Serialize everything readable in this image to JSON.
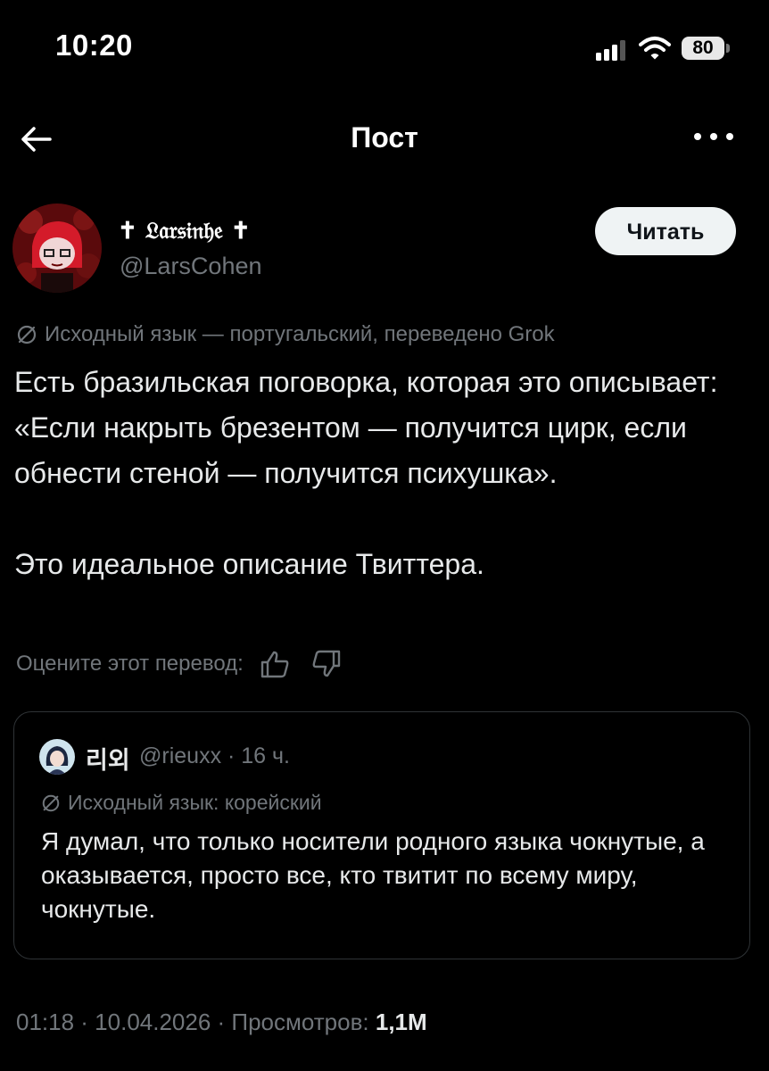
{
  "status_bar": {
    "time": "10:20",
    "battery": "80"
  },
  "nav": {
    "title": "Пост",
    "back_icon": "arrow-left-icon",
    "more_icon": "more-horizontal-icon"
  },
  "post": {
    "author": {
      "display_name": "✝ 𝔏𝔞𝔯𝔰𝔦𝔫𝔥𝔢 ✝",
      "handle": "@LarsCohen"
    },
    "follow_label": "Читать",
    "translation_note": "Исходный язык — португальский, переведено Grok",
    "paragraphs": [
      "Есть бразильская поговорка, которая это описывает: «Если накрыть брезентом — получится цирк, если обнести стеной — получится психушка».",
      "Это идеальное описание Твиттера."
    ],
    "rate_translation": "Оцените этот перевод:",
    "quote": {
      "name": "리외",
      "meta": "@rieuxx · 16 ч.",
      "translation_note": "Исходный язык: корейский",
      "text": "Я думал, что только носители родного языка чокнутые, а оказывается, просто все, кто твитит по всему миру, чокнутые."
    },
    "footer": {
      "time_date": "01:18 · 10.04.2026 · Просмотров: ",
      "views": "1,1M"
    }
  },
  "colors": {
    "background": "#000000",
    "text": "#e7e9ea",
    "muted": "#71767b",
    "border": "#2f3336",
    "button_bg": "#eff3f4"
  }
}
